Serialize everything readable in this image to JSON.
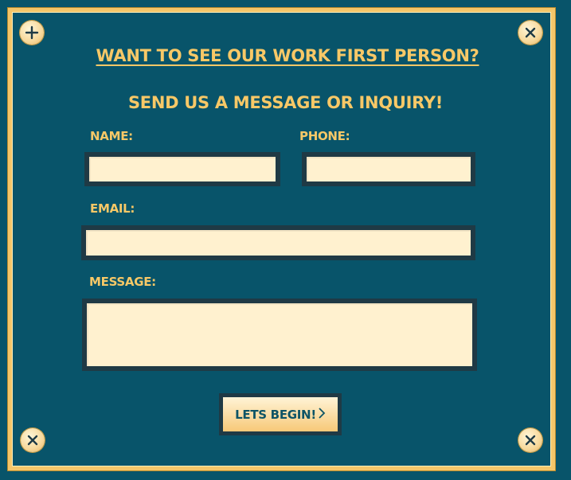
{
  "form": {
    "heading": "WANT TO SEE OUR WORK FIRST PERSON?",
    "subheading": "SEND US A MESSAGE OR INQUIRY!",
    "fields": {
      "name_label": "NAME:",
      "name_value": "",
      "phone_label": "PHONE:",
      "phone_value": "",
      "email_label": "EMAIL:",
      "email_value": "",
      "message_label": "MESSAGE:",
      "message_value": ""
    },
    "submit_label": "LETS BEGIN!",
    "submit_icon": "chevron-right-icon"
  },
  "icons": {
    "corner_screws": [
      "screw-icon",
      "screw-icon",
      "screw-icon",
      "screw-icon"
    ]
  },
  "colors": {
    "background": "#08546a",
    "accent_gold": "#f7c867",
    "field_fill": "#fff1cf",
    "field_border": "#1f3a45"
  }
}
